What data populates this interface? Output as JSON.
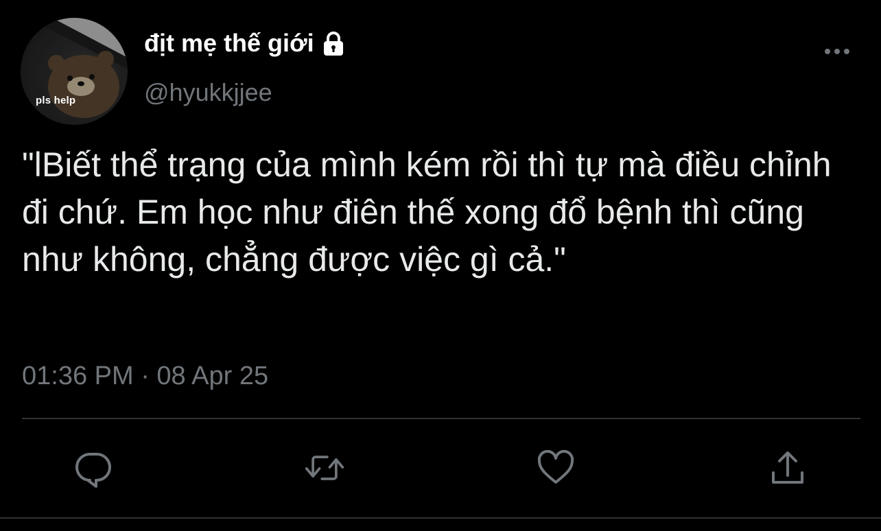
{
  "user": {
    "display_name": "địt mẹ thế giới",
    "handle": "@hyukkjjee",
    "avatar_caption": "pls help",
    "protected": true
  },
  "tweet": {
    "text": "\"lBiết thể trạng của mình kém rồi thì tự mà điều chỉnh đi chứ. Em học như điên thế xong đổ bệnh thì cũng như không, chẳng được việc gì cả.\"",
    "timestamp": "01:36 PM · 08 Apr 25"
  },
  "actions": {
    "reply_icon": "reply-icon",
    "retweet_icon": "retweet-icon",
    "like_icon": "heart-icon",
    "share_icon": "share-icon"
  },
  "colors": {
    "background": "#000000",
    "text": "#e7e9ea",
    "muted": "#71767b",
    "divider": "#2f3336"
  }
}
